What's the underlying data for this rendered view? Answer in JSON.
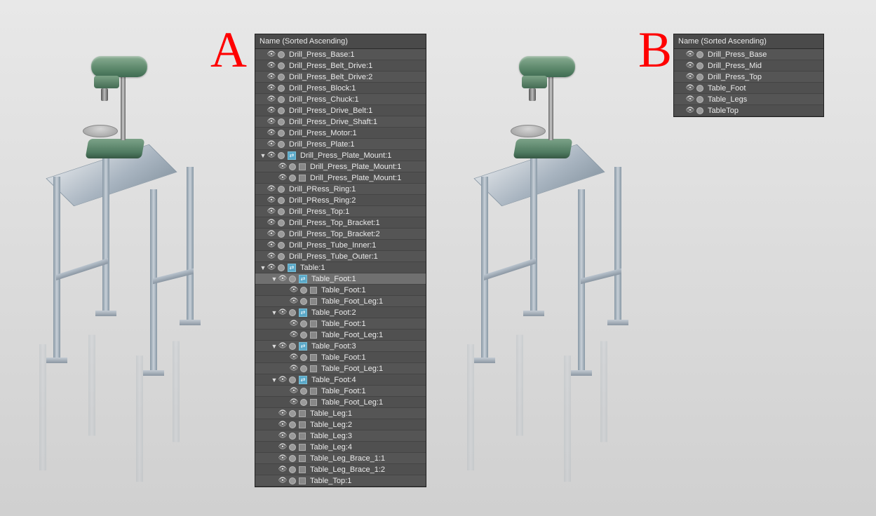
{
  "labels": {
    "A": "A",
    "B": "B"
  },
  "panelA": {
    "header": "Name (Sorted Ascending)",
    "items": [
      {
        "indent": 0,
        "expand": "",
        "link": false,
        "name": "Drill_Press_Base:1"
      },
      {
        "indent": 0,
        "expand": "",
        "link": false,
        "name": "Drill_Press_Belt_Drive:1"
      },
      {
        "indent": 0,
        "expand": "",
        "link": false,
        "name": "Drill_Press_Belt_Drive:2"
      },
      {
        "indent": 0,
        "expand": "",
        "link": false,
        "name": "Drill_Press_Block:1"
      },
      {
        "indent": 0,
        "expand": "",
        "link": false,
        "name": "Drill_Press_Chuck:1"
      },
      {
        "indent": 0,
        "expand": "",
        "link": false,
        "name": "Drill_Press_Drive_Belt:1"
      },
      {
        "indent": 0,
        "expand": "",
        "link": false,
        "name": "Drill_Press_Drive_Shaft:1"
      },
      {
        "indent": 0,
        "expand": "",
        "link": false,
        "name": "Drill_Press_Motor:1"
      },
      {
        "indent": 0,
        "expand": "",
        "link": false,
        "name": "Drill_Press_Plate:1"
      },
      {
        "indent": 0,
        "expand": "▼",
        "link": true,
        "name": "Drill_Press_Plate_Mount:1"
      },
      {
        "indent": 1,
        "expand": "",
        "link": false,
        "mesh": true,
        "name": "Drill_Press_Plate_Mount:1"
      },
      {
        "indent": 1,
        "expand": "",
        "link": false,
        "mesh": true,
        "name": "Drill_Press_Plate_Mount:1"
      },
      {
        "indent": 0,
        "expand": "",
        "link": false,
        "name": "Drill_PRess_Ring:1"
      },
      {
        "indent": 0,
        "expand": "",
        "link": false,
        "name": "Drill_PRess_Ring:2"
      },
      {
        "indent": 0,
        "expand": "",
        "link": false,
        "name": "Drill_Press_Top:1"
      },
      {
        "indent": 0,
        "expand": "",
        "link": false,
        "name": "Drill_Press_Top_Bracket:1"
      },
      {
        "indent": 0,
        "expand": "",
        "link": false,
        "name": "Drill_Press_Top_Bracket:2"
      },
      {
        "indent": 0,
        "expand": "",
        "link": false,
        "name": "Drill_Press_Tube_Inner:1"
      },
      {
        "indent": 0,
        "expand": "",
        "link": false,
        "name": "Drill_Press_Tube_Outer:1"
      },
      {
        "indent": 0,
        "expand": "▼",
        "link": true,
        "name": "Table:1"
      },
      {
        "indent": 1,
        "expand": "▼",
        "link": true,
        "name": "Table_Foot:1",
        "selected": true
      },
      {
        "indent": 2,
        "expand": "",
        "link": false,
        "mesh": true,
        "name": "Table_Foot:1"
      },
      {
        "indent": 2,
        "expand": "",
        "link": false,
        "mesh": true,
        "name": "Table_Foot_Leg:1"
      },
      {
        "indent": 1,
        "expand": "▼",
        "link": true,
        "name": "Table_Foot:2"
      },
      {
        "indent": 2,
        "expand": "",
        "link": false,
        "mesh": true,
        "name": "Table_Foot:1"
      },
      {
        "indent": 2,
        "expand": "",
        "link": false,
        "mesh": true,
        "name": "Table_Foot_Leg:1"
      },
      {
        "indent": 1,
        "expand": "▼",
        "link": true,
        "name": "Table_Foot:3"
      },
      {
        "indent": 2,
        "expand": "",
        "link": false,
        "mesh": true,
        "name": "Table_Foot:1"
      },
      {
        "indent": 2,
        "expand": "",
        "link": false,
        "mesh": true,
        "name": "Table_Foot_Leg:1"
      },
      {
        "indent": 1,
        "expand": "▼",
        "link": true,
        "name": "Table_Foot:4"
      },
      {
        "indent": 2,
        "expand": "",
        "link": false,
        "mesh": true,
        "name": "Table_Foot:1"
      },
      {
        "indent": 2,
        "expand": "",
        "link": false,
        "mesh": true,
        "name": "Table_Foot_Leg:1"
      },
      {
        "indent": 1,
        "expand": "",
        "link": false,
        "mesh": true,
        "name": "Table_Leg:1"
      },
      {
        "indent": 1,
        "expand": "",
        "link": false,
        "mesh": true,
        "name": "Table_Leg:2"
      },
      {
        "indent": 1,
        "expand": "",
        "link": false,
        "mesh": true,
        "name": "Table_Leg:3"
      },
      {
        "indent": 1,
        "expand": "",
        "link": false,
        "mesh": true,
        "name": "Table_Leg:4"
      },
      {
        "indent": 1,
        "expand": "",
        "link": false,
        "mesh": true,
        "name": "Table_Leg_Brace_1:1"
      },
      {
        "indent": 1,
        "expand": "",
        "link": false,
        "mesh": true,
        "name": "Table_Leg_Brace_1:2"
      },
      {
        "indent": 1,
        "expand": "",
        "link": false,
        "mesh": true,
        "name": "Table_Top:1"
      }
    ]
  },
  "panelB": {
    "header": "Name (Sorted Ascending)",
    "items": [
      {
        "name": "Drill_Press_Base"
      },
      {
        "name": "Drill_Press_Mid"
      },
      {
        "name": "Drill_Press_Top"
      },
      {
        "name": "Table_Foot"
      },
      {
        "name": "Table_Legs"
      },
      {
        "name": "TableTop"
      }
    ]
  }
}
